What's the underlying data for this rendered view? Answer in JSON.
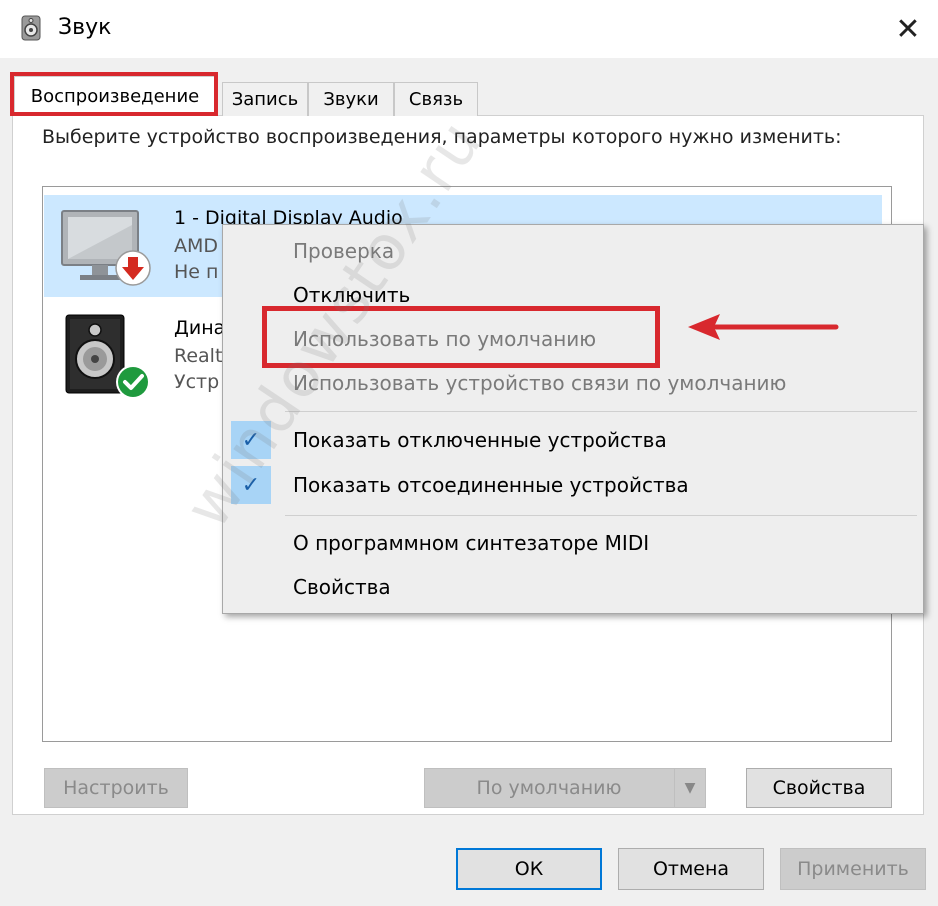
{
  "window": {
    "title": "Звук",
    "title_icon": "speaker-icon",
    "close_glyph": "✕"
  },
  "tabs": [
    {
      "label": "Воспроизведение",
      "active": true
    },
    {
      "label": "Запись"
    },
    {
      "label": "Звуки"
    },
    {
      "label": "Связь"
    }
  ],
  "instruction": "Выберите устройство воспроизведения, параметры которого нужно изменить:",
  "devices": [
    {
      "name": "1 - Digital Display Audio",
      "driver": "AMD",
      "status": "Не п",
      "icon": "monitor-icon",
      "badge": "red-down-arrow-icon",
      "selected": true
    },
    {
      "name": "Дина",
      "driver": "Realt",
      "status": "Устр",
      "icon": "speaker-icon",
      "badge": "green-check-icon"
    }
  ],
  "context_menu": {
    "items": [
      {
        "label": "Проверка",
        "disabled": true
      },
      {
        "label": "Отключить"
      },
      {
        "label": "Использовать по умолчанию",
        "disabled": true,
        "highlighted": true
      },
      {
        "label": "Использовать устройство связи по умолчанию",
        "disabled": true
      },
      {
        "label": "Показать отключенные устройства",
        "checked": true
      },
      {
        "label": "Показать отсоединенные устройства",
        "checked": true
      },
      {
        "label": "О программном синтезаторе MIDI"
      },
      {
        "label": "Свойства"
      }
    ],
    "check_glyph": "✓"
  },
  "buttons": {
    "configure": "Настроить",
    "set_default": "По умолчанию",
    "properties": "Свойства",
    "ok": "ОК",
    "cancel": "Отмена",
    "apply": "Применить"
  },
  "watermark": "windowstox.ru",
  "colors": {
    "highlight_red": "#d8282e",
    "selected_row": "#cce8ff",
    "check_bg": "#a8d4f6"
  }
}
